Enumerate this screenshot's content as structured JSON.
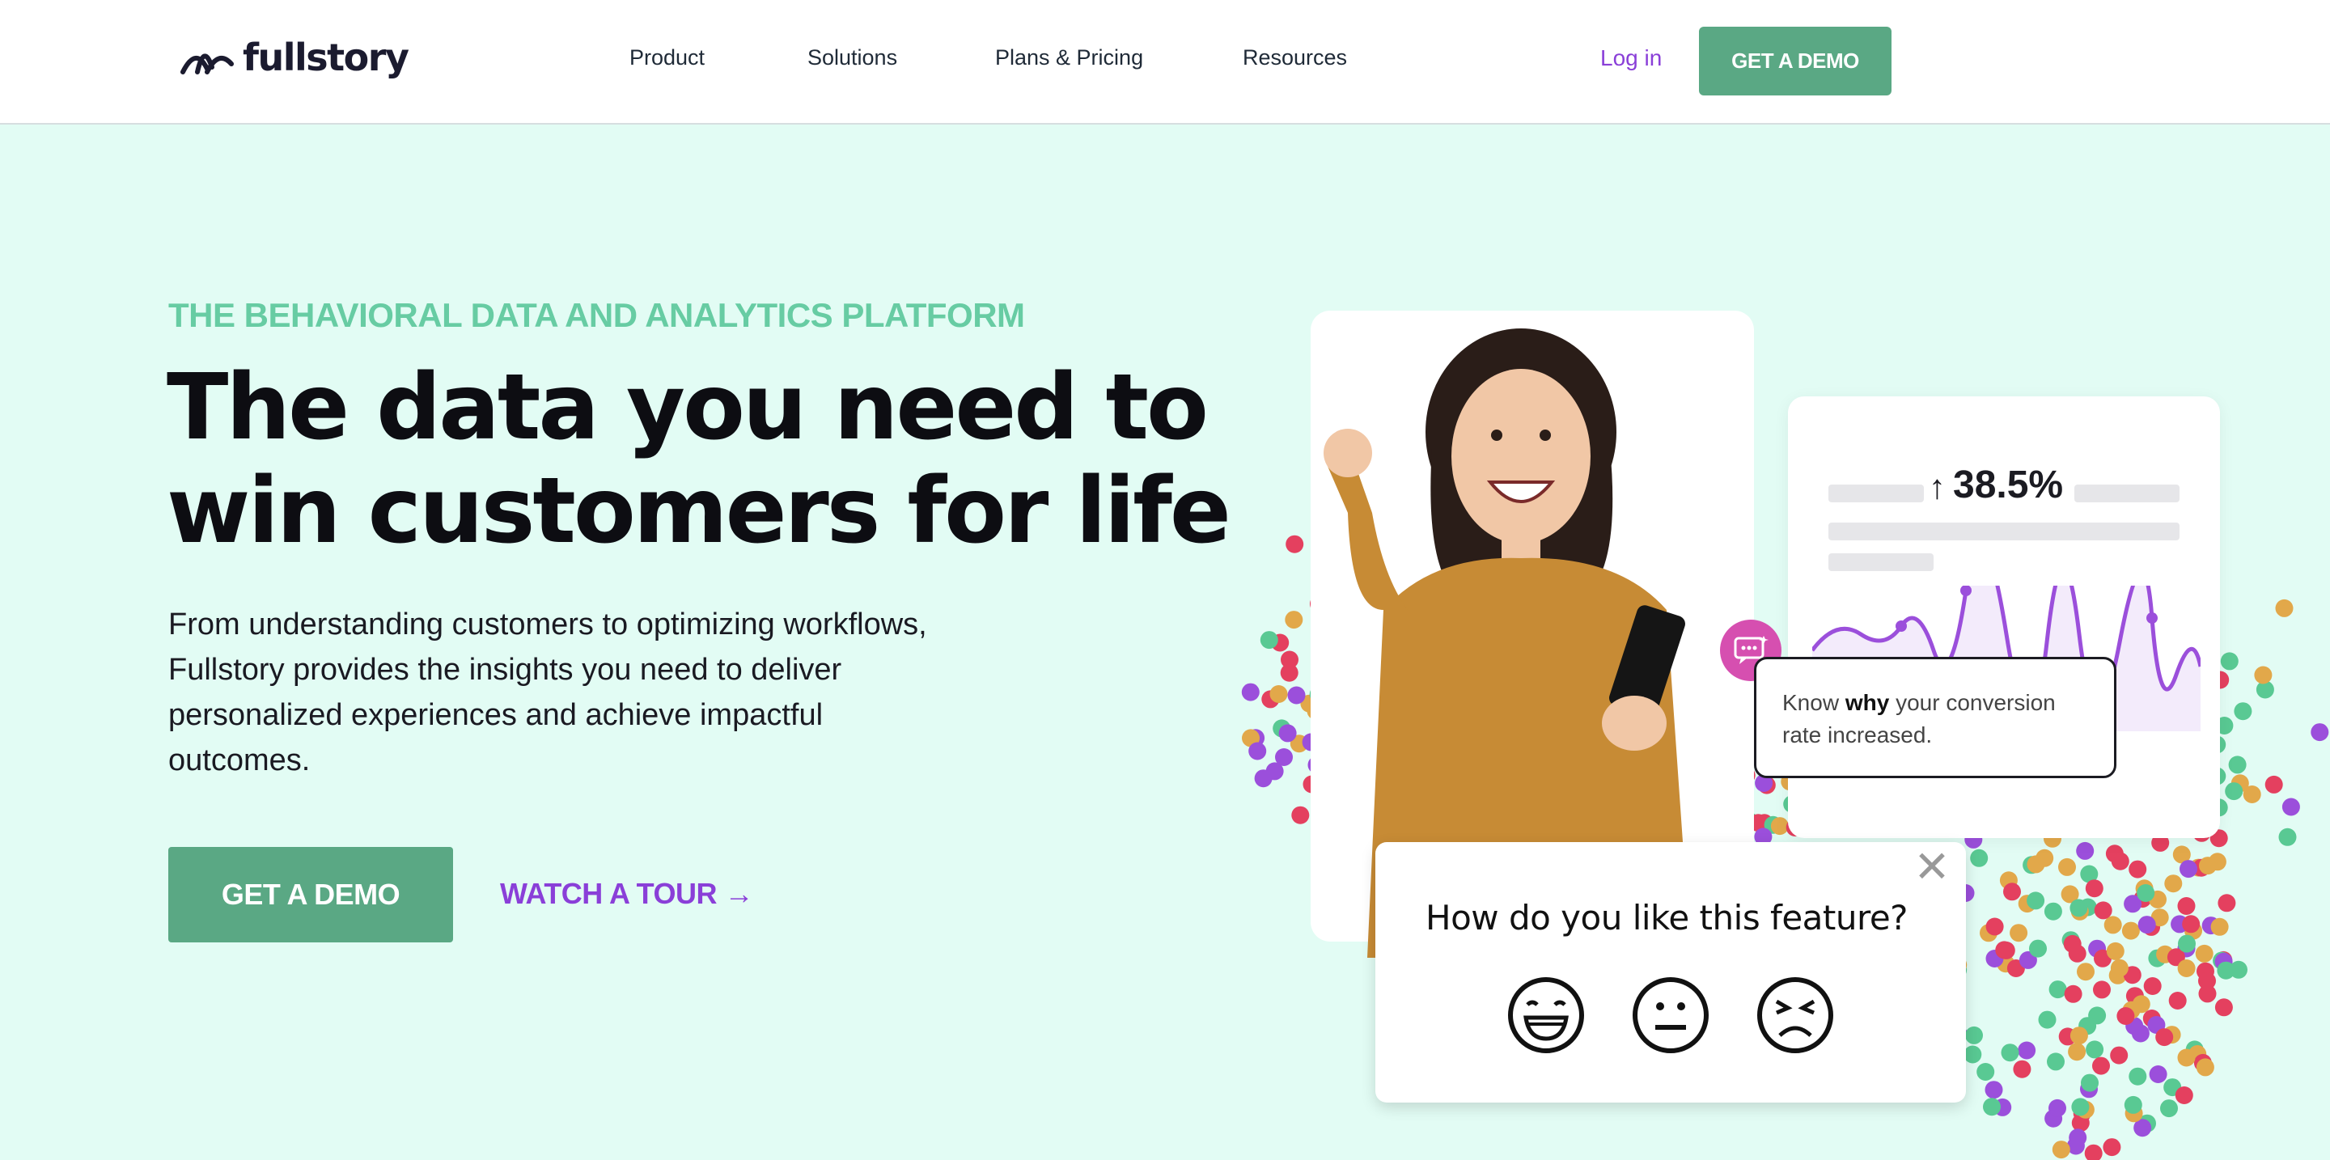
{
  "header": {
    "brand": "fullstory",
    "nav": [
      "Product",
      "Solutions",
      "Plans & Pricing",
      "Resources"
    ],
    "login": "Log in",
    "cta": "GET A DEMO"
  },
  "hero": {
    "eyebrow": "THE BEHAVIORAL DATA AND ANALYTICS PLATFORM",
    "headline_line1": "The data you need to",
    "headline_line2": "win customers for life",
    "subcopy": "From understanding customers to optimizing workflows, Fullstory provides the insights you need to deliver personalized experiences and achieve impactful outcomes.",
    "cta_primary": "GET A DEMO",
    "cta_secondary": "WATCH A TOUR →"
  },
  "visual": {
    "stat": "38.5%",
    "insight_pre": "Know ",
    "insight_bold": "why",
    "insight_post": " your conversion rate increased.",
    "feedback_question": "How do you like this feature?",
    "close_symbol": "✕",
    "faces": [
      "happy-face-icon",
      "neutral-face-icon",
      "upset-face-icon"
    ]
  },
  "colors": {
    "accent_green": "#5aa884",
    "eyebrow_green": "#67cca3",
    "purple": "#8a3fd8",
    "hero_bg": "#e2fcf4",
    "pink": "#d64fb0"
  }
}
